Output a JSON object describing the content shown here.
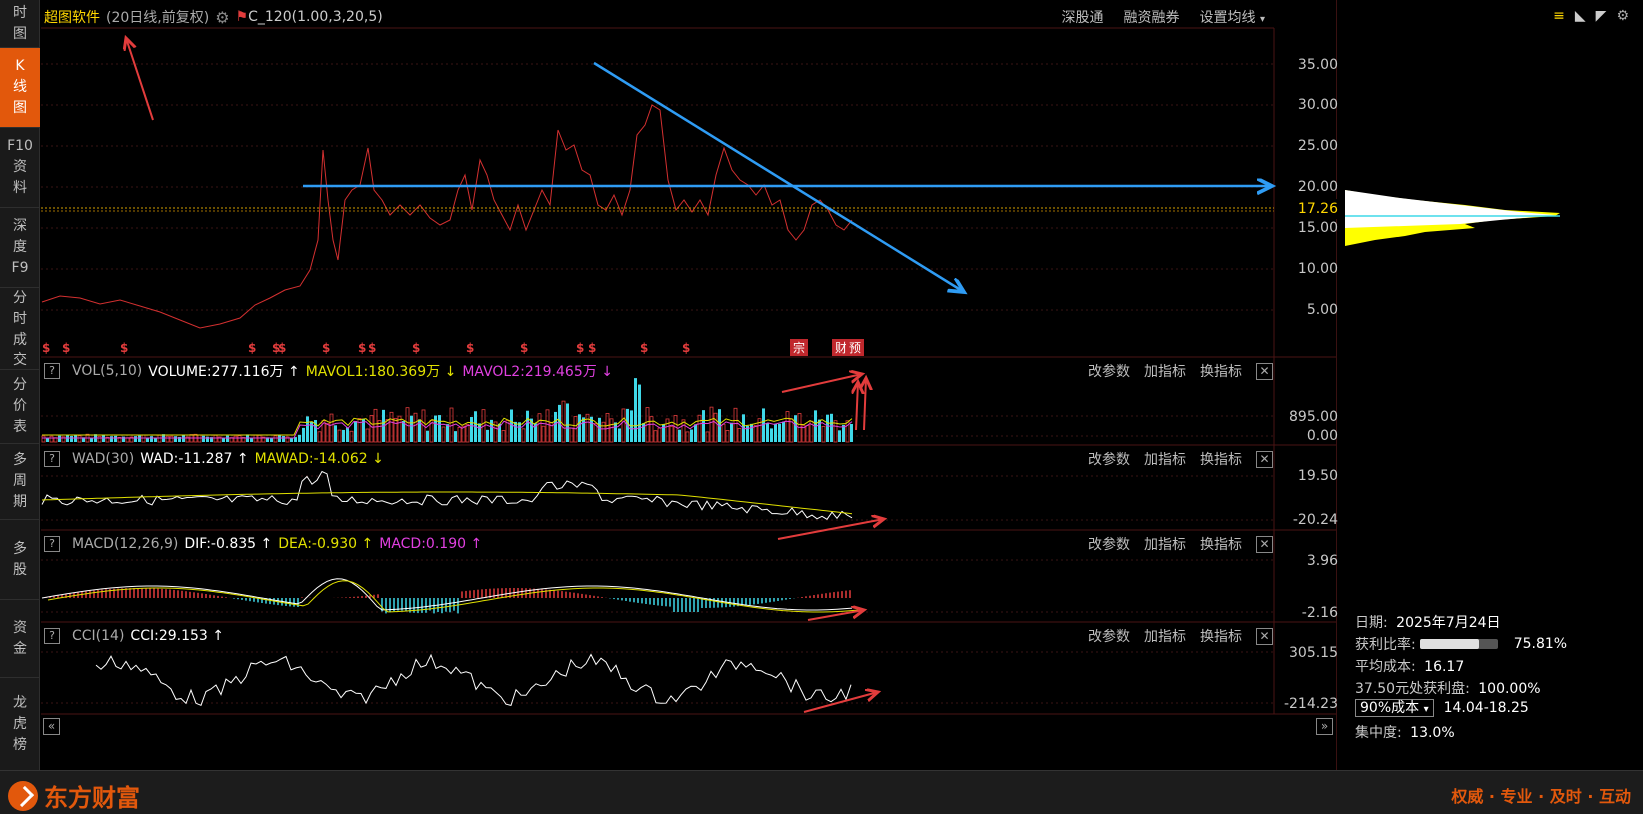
{
  "sidebar": {
    "items": [
      {
        "line1": "时",
        "line2": "图",
        "line3": ""
      },
      {
        "line1": "K",
        "line2": "线",
        "line3": "图"
      },
      {
        "line1": "F10",
        "line2": "资",
        "line3": "料"
      },
      {
        "line1": "深",
        "line2": "度",
        "line3": "F9"
      },
      {
        "line1": "分",
        "line2": "时",
        "line3": "成交"
      },
      {
        "line1": "分",
        "line2": "价",
        "line3": "表"
      },
      {
        "line1": "多",
        "line2": "周",
        "line3": "期"
      },
      {
        "line1": "多",
        "line2": "股",
        "line3": ""
      },
      {
        "line1": "资",
        "line2": "金",
        "line3": ""
      },
      {
        "line1": "龙",
        "line2": "虎",
        "line3": "榜"
      }
    ]
  },
  "main": {
    "title": "超图软件",
    "ma_note": "(20日线,前复权)",
    "indicator": "C_120(1.00,3,20,5)",
    "tools": [
      "深股通",
      "融资融券",
      "设置均线"
    ],
    "y_labels": [
      "35.00",
      "30.00",
      "25.00",
      "20.00",
      "15.00",
      "10.00",
      "5.00"
    ],
    "price_tag": "17.26",
    "markers": [
      "宗",
      "财",
      "预"
    ]
  },
  "vol": {
    "name": "VOL(5,10)",
    "v1": "VOLUME:277.116万",
    "v2": "MAVOL1:180.369万",
    "v3": "MAVOL2:219.465万",
    "y_top": "895.00",
    "y_bottom": "0.00"
  },
  "wad": {
    "name": "WAD(30)",
    "v1": "WAD:-11.287",
    "v2": "MAWAD:-14.062",
    "y_top": "19.50",
    "y_bottom": "-20.24"
  },
  "macd": {
    "name": "MACD(12,26,9)",
    "v1": "DIF:-0.835",
    "v2": "DEA:-0.930",
    "v3": "MACD:0.190",
    "y_top": "3.96",
    "y_bottom": "-2.16"
  },
  "cci": {
    "name": "CCI(14)",
    "v1": "CCI:29.153",
    "y_top": "305.15",
    "y_bottom": "-214.23"
  },
  "panel_tools": [
    "改参数",
    "加指标",
    "换指标"
  ],
  "right_panel": {
    "date_label": "日期:",
    "date_value": "2025年7月24日",
    "profit_label": "获利比率:",
    "profit_value": "75.81%",
    "profit_ratio": 0.7581,
    "avg_cost_label": "平均成本:",
    "avg_cost_value": "16.17",
    "profit_at_label": "37.50元处获利盘:",
    "profit_at_value": "100.00%",
    "cost_select": "90%成本",
    "cost_range": "14.04-18.25",
    "concentration_label": "集中度:",
    "concentration_value": "13.0%"
  },
  "bottom": {
    "brand": "东方财富",
    "slogan": "权威 · 专业 · 及时 · 互动"
  },
  "colors": {
    "accent": "#e2580c",
    "price_line": "#d43030",
    "trend_blue": "#2f9cf4",
    "annot_red": "#e23c3c",
    "vol_up": "#e23c3c",
    "vol_down": "#3fd8e8",
    "mavol1": "#e0e000",
    "mavol2": "#e040e0",
    "chip_yellow": "#ffff00"
  }
}
